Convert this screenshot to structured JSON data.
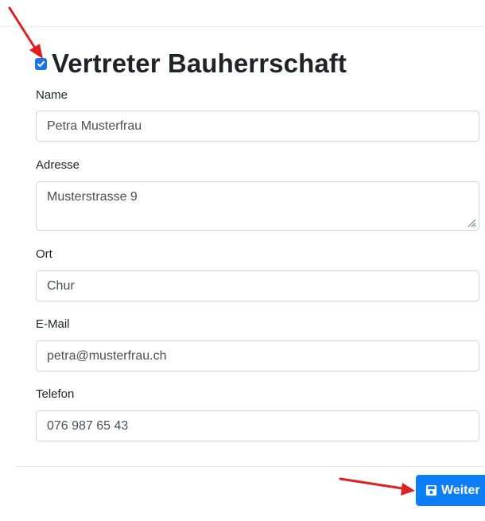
{
  "section": {
    "title": "Vertreter Bauherrschaft",
    "checkbox_checked": true
  },
  "form": {
    "name_label": "Name",
    "name_value": "Petra Musterfrau",
    "address_label": "Adresse",
    "address_value": "Musterstrasse 9",
    "city_label": "Ort",
    "city_value": "Chur",
    "email_label": "E-Mail",
    "email_value": "petra@musterfrau.ch",
    "phone_label": "Telefon",
    "phone_value": "076 987 65 43"
  },
  "actions": {
    "next_label": "Weiter",
    "next_icon": "save-icon"
  },
  "colors": {
    "accent": "#0d7ef5",
    "annotation_arrow": "#e02020"
  }
}
